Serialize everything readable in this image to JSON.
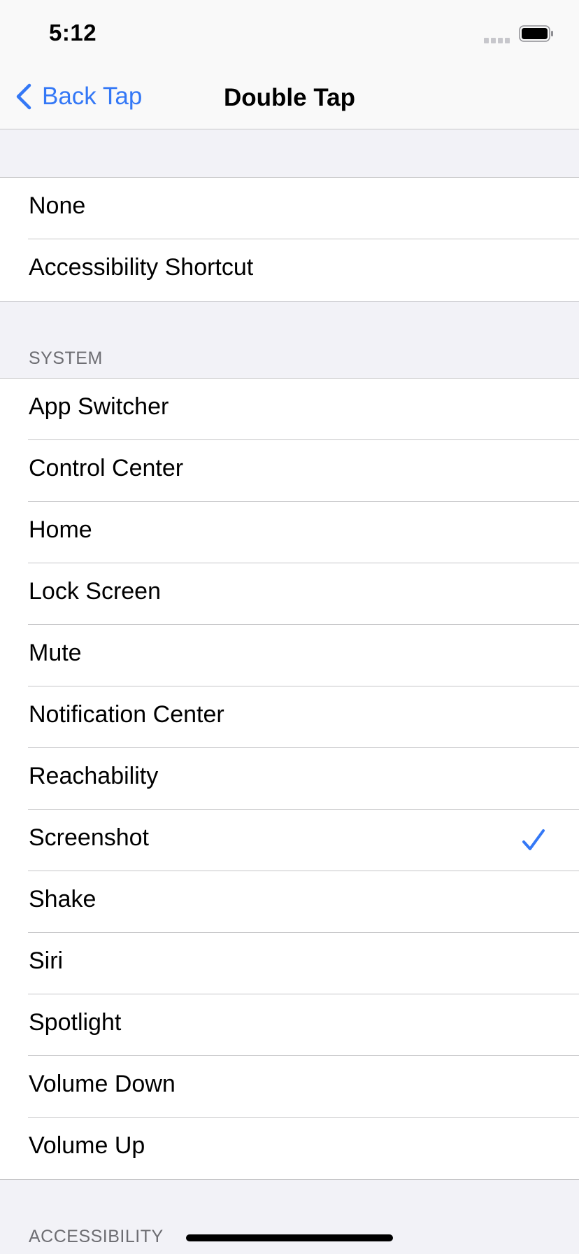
{
  "status_bar": {
    "time": "5:12"
  },
  "nav": {
    "back_label": "Back Tap",
    "title": "Double Tap"
  },
  "colors": {
    "accent": "#3478f6",
    "background": "#f2f2f7",
    "separator": "#c6c6c8",
    "section_header": "#6d6d72"
  },
  "group1": {
    "items": [
      {
        "label": "None"
      },
      {
        "label": "Accessibility Shortcut"
      }
    ]
  },
  "system": {
    "header": "SYSTEM",
    "items": [
      {
        "label": "App Switcher"
      },
      {
        "label": "Control Center"
      },
      {
        "label": "Home"
      },
      {
        "label": "Lock Screen"
      },
      {
        "label": "Mute"
      },
      {
        "label": "Notification Center"
      },
      {
        "label": "Reachability"
      },
      {
        "label": "Screenshot",
        "selected": true
      },
      {
        "label": "Shake"
      },
      {
        "label": "Siri"
      },
      {
        "label": "Spotlight"
      },
      {
        "label": "Volume Down"
      },
      {
        "label": "Volume Up"
      }
    ]
  },
  "accessibility": {
    "header": "ACCESSIBILITY"
  },
  "icons": {
    "back": "chevron-left-icon",
    "selected": "checkmark-icon",
    "battery": "battery-icon",
    "signal": "signal-icon"
  }
}
